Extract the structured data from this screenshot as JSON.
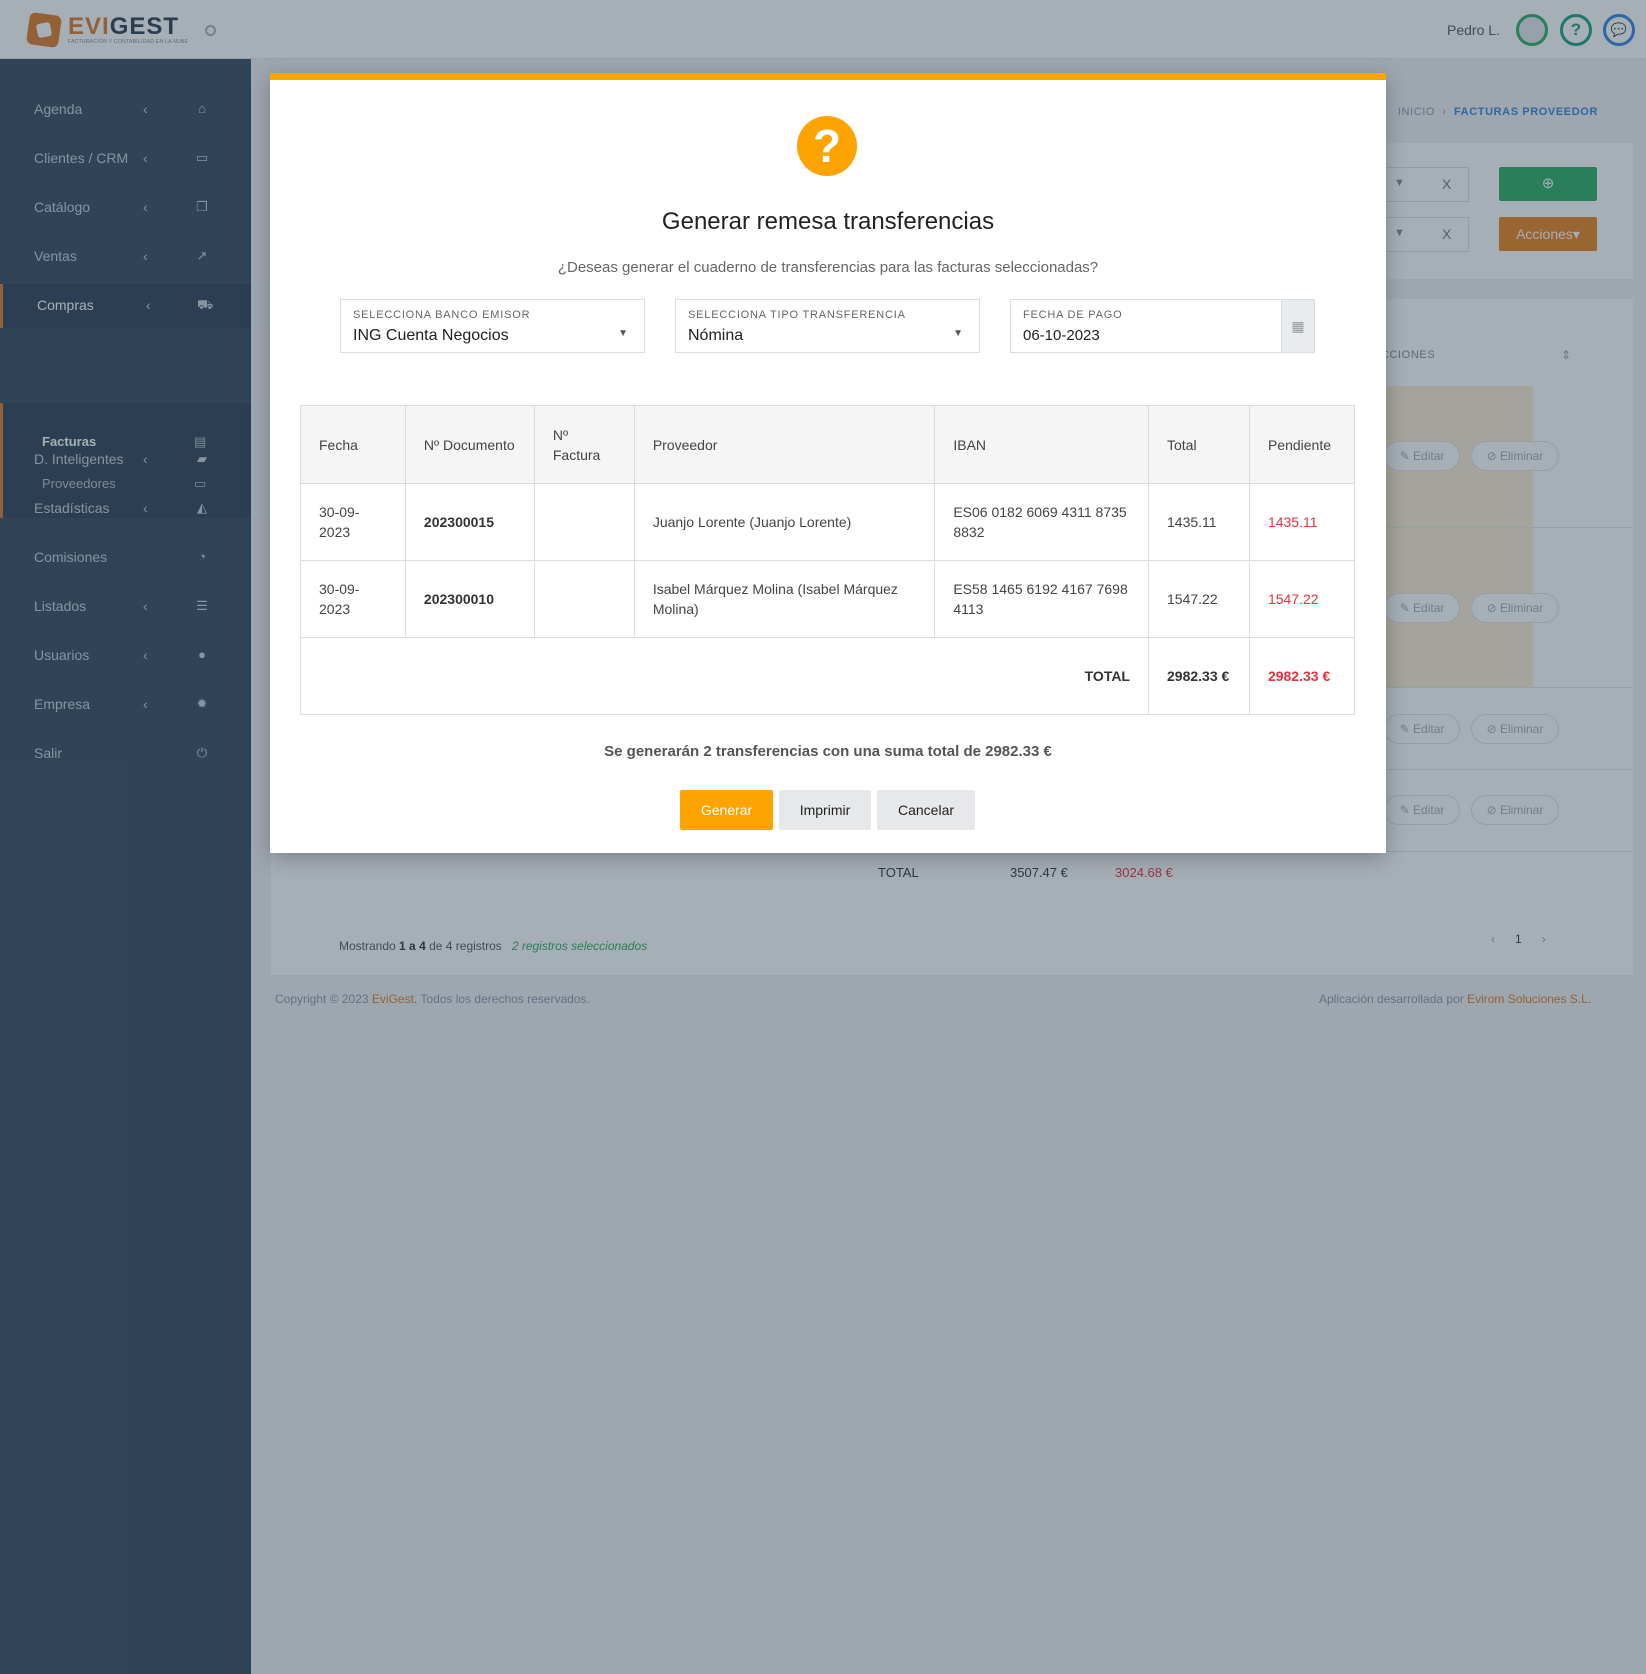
{
  "header": {
    "logo_word_a": "EVI",
    "logo_word_b": "GEST",
    "logo_tagline": "FACTURACIÓN Y CONTABILIDAD EN LA NUBE",
    "user_name": "Pedro L.",
    "help_glyph": "?",
    "chat_glyph": "💬"
  },
  "sidebar": {
    "items": [
      {
        "label": "Agenda",
        "icon": "home-icon",
        "glyph": "⌂",
        "chevron": "‹"
      },
      {
        "label": "Clientes / CRM",
        "icon": "id-card-icon",
        "glyph": "▭",
        "chevron": "‹"
      },
      {
        "label": "Catálogo",
        "icon": "copy-icon",
        "glyph": "❐",
        "chevron": "‹"
      },
      {
        "label": "Ventas",
        "icon": "line-chart-icon",
        "glyph": "↗",
        "chevron": "‹"
      },
      {
        "label": "Compras",
        "icon": "cart-icon",
        "glyph": "⛟",
        "chevron": "‹"
      },
      {
        "label": "D. Inteligentes",
        "icon": "folder-open-icon",
        "glyph": "▰",
        "chevron": "‹"
      },
      {
        "label": "Estadísticas",
        "icon": "area-chart-icon",
        "glyph": "◭",
        "chevron": "‹"
      },
      {
        "label": "Comisiones",
        "icon": "pie-chart-icon",
        "glyph": "◔",
        "chevron": ""
      },
      {
        "label": "Listados",
        "icon": "list-icon",
        "glyph": "☰",
        "chevron": "‹"
      },
      {
        "label": "Usuarios",
        "icon": "user-icon",
        "glyph": "●",
        "chevron": "‹"
      },
      {
        "label": "Empresa",
        "icon": "gear-icon",
        "glyph": "✹",
        "chevron": "‹"
      },
      {
        "label": "Salir",
        "icon": "power-icon",
        "glyph": "⏻",
        "chevron": ""
      }
    ],
    "subitems": [
      {
        "label": "Facturas",
        "glyph": "▤"
      },
      {
        "label": "Proveedores",
        "glyph": "▭"
      }
    ]
  },
  "page": {
    "breadcrumb_home": "INICIO",
    "breadcrumb_sep": "›",
    "breadcrumb_current": "FACTURAS PROVEEDOR",
    "filter_clear": "X",
    "add_glyph": "⊕",
    "actions_label": "Acciones▾",
    "col_acciones": "ACCIONES",
    "edit_label": "✎ Editar",
    "delete_label": "⊘ Eliminar",
    "total_label": "TOTAL",
    "total_amount": "3507.47 €",
    "total_pending": "3024.68 €",
    "showing_pre": "Mostrando",
    "showing_range": "1 a 4",
    "showing_mid": "de 4 registros",
    "selected_text": "2 registros seleccionados",
    "pager_prev": "‹",
    "pager_page": "1",
    "pager_next": "›"
  },
  "footer": {
    "copyright_pre": "Copyright © 2023",
    "copyright_brand": "EviGest.",
    "copyright_post": "Todos los derechos reservados.",
    "dev_pre": "Aplicación desarrollada por",
    "dev_brand": "Evirom Soluciones S.L."
  },
  "modal": {
    "icon_glyph": "?",
    "title": "Generar remesa transferencias",
    "subtitle": "¿Deseas generar el cuaderno de transferencias para las facturas seleccionadas?",
    "bank_label": "SELECCIONA BANCO EMISOR",
    "bank_value": "ING Cuenta Negocios",
    "type_label": "SELECCIONA TIPO TRANSFERENCIA",
    "type_value": "Nómina",
    "date_label": "FECHA DE PAGO",
    "date_value": "06-10-2023",
    "columns": [
      "Fecha",
      "Nº Documento",
      "Nº Factura",
      "Proveedor",
      "IBAN",
      "Total",
      "Pendiente"
    ],
    "rows": [
      {
        "fecha": "30-09-2023",
        "documento": "202300015",
        "factura": "",
        "proveedor": "Juanjo Lorente (Juanjo Lorente)",
        "iban": "ES06 0182 6069 4311 8735 8832",
        "total": "1435.11",
        "pendiente": "1435.11"
      },
      {
        "fecha": "30-09-2023",
        "documento": "202300010",
        "factura": "",
        "proveedor": "Isabel Márquez Molina (Isabel Márquez Molina)",
        "iban": "ES58 1465 6192 4167 7698 4113",
        "total": "1547.22",
        "pendiente": "1547.22"
      }
    ],
    "total_label": "TOTAL",
    "total_value": "2982.33 €",
    "pending_value": "2982.33 €",
    "summary": "Se generarán 2 transferencias con una suma total de 2982.33 €",
    "btn_generate": "Generar",
    "btn_print": "Imprimir",
    "btn_cancel": "Cancelar"
  },
  "colors": {
    "accent": "#ffa300",
    "sidebar": "#34495e",
    "pending_red": "#e8313c",
    "success": "#27ae60"
  }
}
